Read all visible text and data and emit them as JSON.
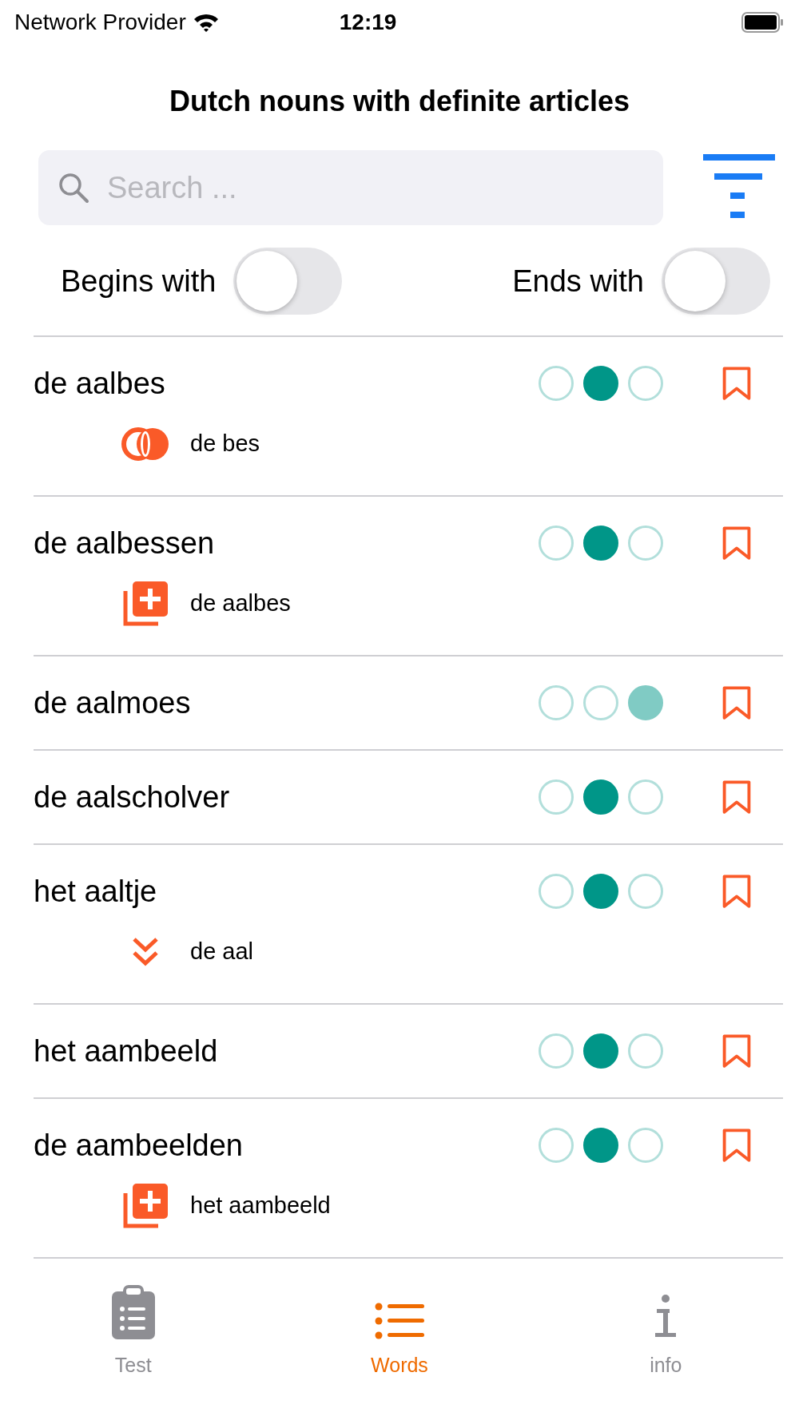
{
  "status_bar": {
    "carrier": "Network Provider",
    "time": "12:19"
  },
  "title": "Dutch nouns with definite articles",
  "search": {
    "placeholder": "Search ..."
  },
  "toggles": [
    {
      "label": "Begins with",
      "on": false
    },
    {
      "label": "Ends with",
      "on": false
    }
  ],
  "words": [
    {
      "word": "de aalbes",
      "color": "#009688",
      "dots": [
        {
          "filled": false
        },
        {
          "filled": true
        },
        {
          "filled": false
        }
      ],
      "bookmarked": false,
      "related": {
        "kind": "compound",
        "text": "de bes"
      }
    },
    {
      "word": "de aalbessen",
      "color": "#009688",
      "dots": [
        {
          "filled": false
        },
        {
          "filled": true
        },
        {
          "filled": false
        }
      ],
      "bookmarked": false,
      "related": {
        "kind": "plural",
        "text": "de aalbes"
      }
    },
    {
      "word": "de aalmoes",
      "color": "#80cbc4",
      "dots": [
        {
          "filled": false
        },
        {
          "filled": false
        },
        {
          "filled": true
        }
      ],
      "bookmarked": false
    },
    {
      "word": "de aalscholver",
      "color": "#009688",
      "dots": [
        {
          "filled": false
        },
        {
          "filled": true
        },
        {
          "filled": false
        }
      ],
      "bookmarked": false
    },
    {
      "word": "het aaltje",
      "color": "#009688",
      "dots": [
        {
          "filled": false
        },
        {
          "filled": true
        },
        {
          "filled": false
        }
      ],
      "bookmarked": false,
      "related": {
        "kind": "diminutive",
        "text": "de aal"
      }
    },
    {
      "word": "het aambeeld",
      "color": "#009688",
      "dots": [
        {
          "filled": false
        },
        {
          "filled": true
        },
        {
          "filled": false
        }
      ],
      "bookmarked": false
    },
    {
      "word": "de aambeelden",
      "color": "#009688",
      "dots": [
        {
          "filled": false
        },
        {
          "filled": true
        },
        {
          "filled": false
        }
      ],
      "bookmarked": false,
      "related": {
        "kind": "plural",
        "text": "het aambeeld"
      }
    }
  ],
  "tabs": [
    {
      "label": "Test",
      "kind": "test",
      "selected": false
    },
    {
      "label": "Words",
      "kind": "words",
      "selected": true
    },
    {
      "label": "info",
      "kind": "info",
      "selected": false
    }
  ]
}
